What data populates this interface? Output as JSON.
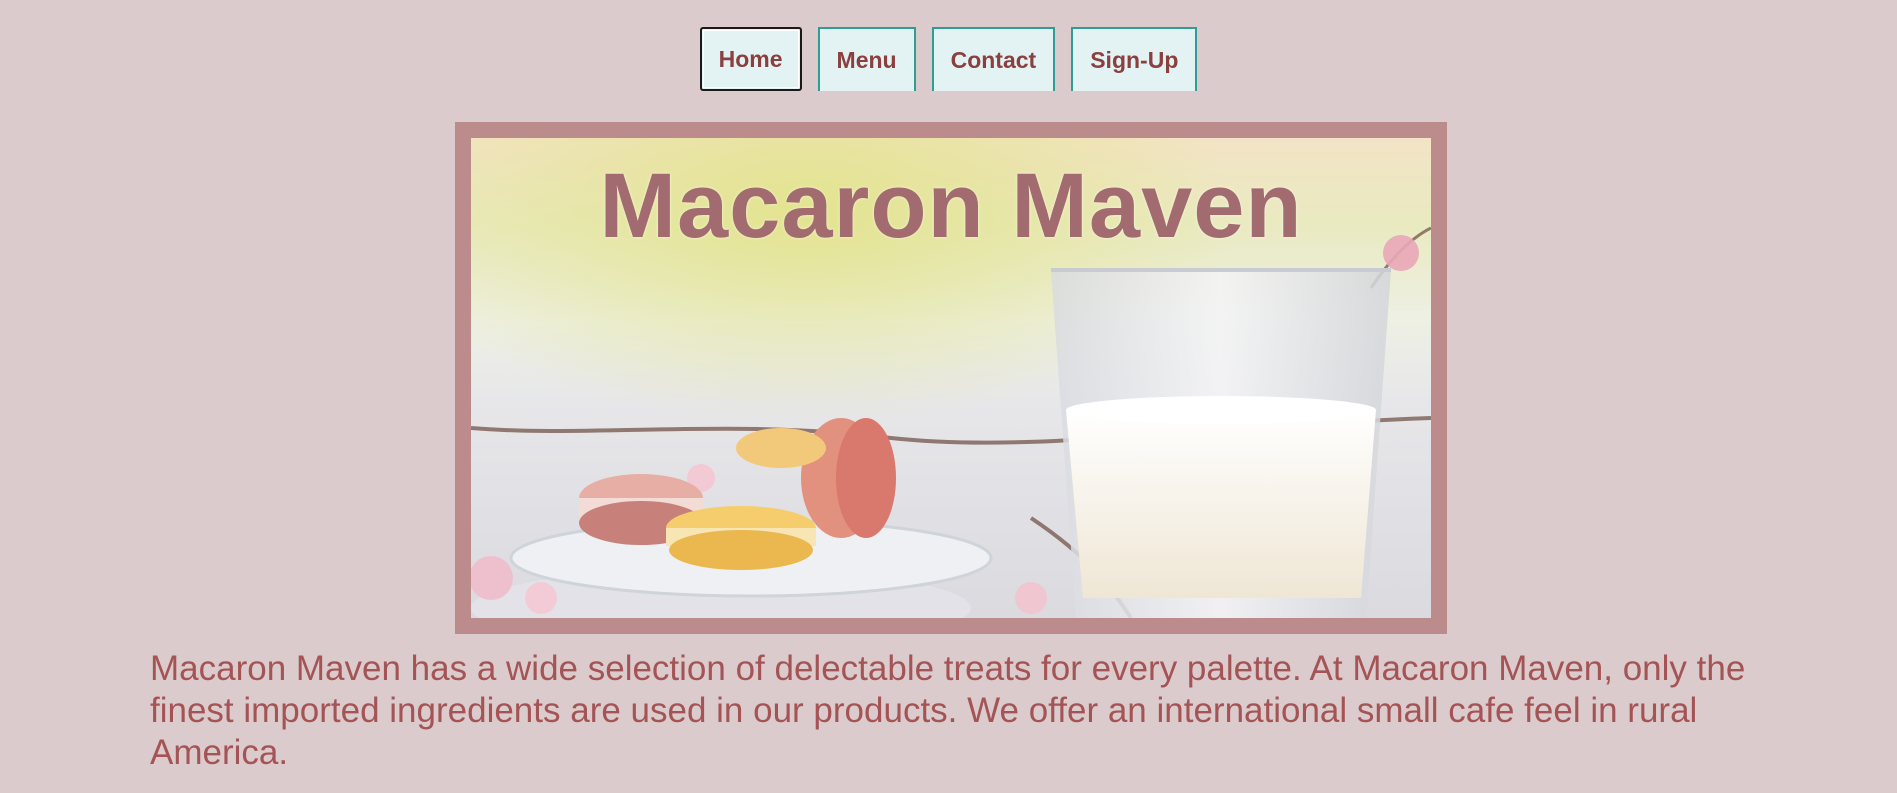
{
  "nav": {
    "items": [
      {
        "label": "Home",
        "active": true
      },
      {
        "label": "Menu",
        "active": false
      },
      {
        "label": "Contact",
        "active": false
      },
      {
        "label": "Sign-Up",
        "active": false
      }
    ]
  },
  "hero": {
    "title": "Macaron Maven",
    "image": "macarons-and-milk-photo"
  },
  "description": "Macaron Maven has a wide selection of delectable treats for every palette. At Macaron Maven, only the finest imported ingredients are used in our products. We offer an international small cafe feel in rural America.",
  "colors": {
    "background": "#dbcbcc",
    "accent_text": "#a55456",
    "nav_border": "#2e9d94",
    "nav_bg": "#e3f2f3",
    "hero_frame": "#bb8c8b",
    "title": "#a26b70"
  }
}
